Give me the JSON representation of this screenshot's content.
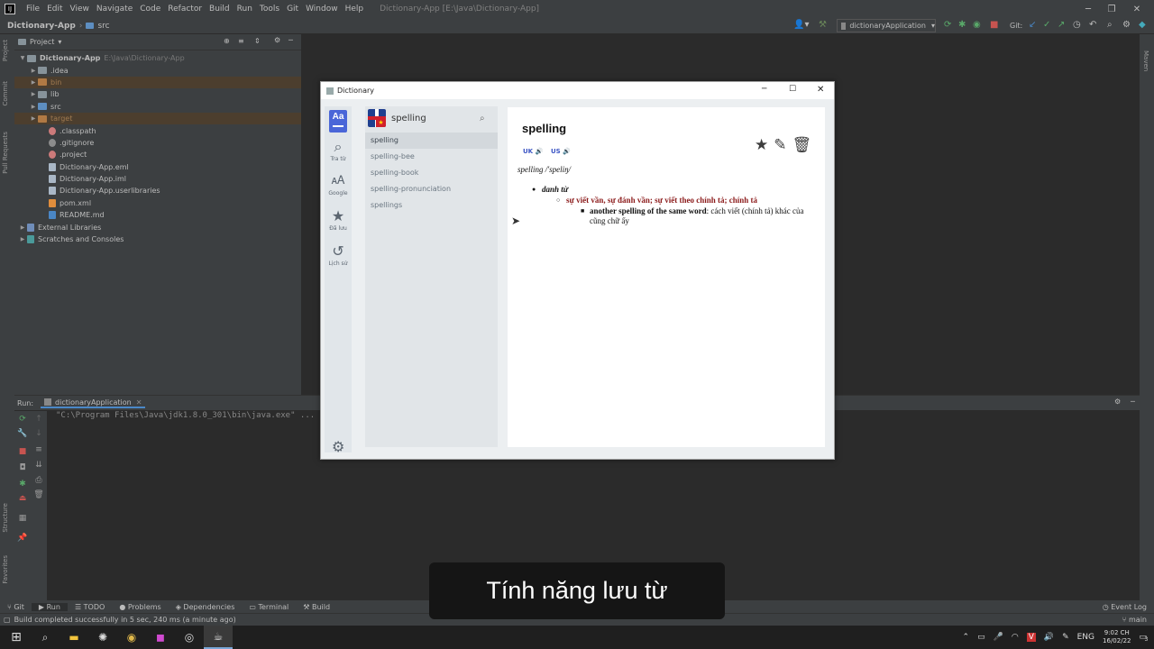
{
  "ide": {
    "menu": [
      "File",
      "Edit",
      "View",
      "Navigate",
      "Code",
      "Refactor",
      "Build",
      "Run",
      "Tools",
      "Git",
      "Window",
      "Help"
    ],
    "window_title": "Dictionary-App [E:\\Java\\Dictionary-App]",
    "breadcrumb": {
      "project": "Dictionary-App",
      "folder": "src"
    },
    "run_config": "dictionaryApplication",
    "git_label": "Git:",
    "left_strip": [
      "Project",
      "Commit",
      "Pull Requests",
      "Structure",
      "Favorites"
    ],
    "right_strip": [
      "Maven"
    ],
    "project_panel_title": "Project",
    "tree": [
      {
        "name": "Dictionary-App",
        "extra": "E:\\Java\\Dictionary-App",
        "level": 0,
        "type": "folder"
      },
      {
        "name": ".idea",
        "level": 1,
        "type": "folder"
      },
      {
        "name": "bin",
        "level": 1,
        "type": "folder-excluded"
      },
      {
        "name": "lib",
        "level": 1,
        "type": "folder"
      },
      {
        "name": "src",
        "level": 1,
        "type": "folder-src"
      },
      {
        "name": "target",
        "level": 1,
        "type": "folder-excluded"
      },
      {
        "name": ".classpath",
        "level": 2,
        "type": "file-red"
      },
      {
        "name": ".gitignore",
        "level": 2,
        "type": "file-grey"
      },
      {
        "name": ".project",
        "level": 2,
        "type": "file-red"
      },
      {
        "name": "Dictionary-App.eml",
        "level": 2,
        "type": "file"
      },
      {
        "name": "Dictionary-App.iml",
        "level": 2,
        "type": "file"
      },
      {
        "name": "Dictionary-App.userlibraries",
        "level": 2,
        "type": "file"
      },
      {
        "name": "pom.xml",
        "level": 2,
        "type": "file-m"
      },
      {
        "name": "README.md",
        "level": 2,
        "type": "file-md"
      },
      {
        "name": "External Libraries",
        "level": 0,
        "type": "lib"
      },
      {
        "name": "Scratches and Consoles",
        "level": 0,
        "type": "scratch"
      }
    ],
    "run_label": "Run:",
    "run_tab": "dictionaryApplication",
    "console_line": "\"C:\\Program Files\\Java\\jdk1.8.0_301\\bin\\java.exe\" ...",
    "bottom_tabs": [
      "Git",
      "Run",
      "TODO",
      "Problems",
      "Dependencies",
      "Terminal",
      "Build"
    ],
    "event_log": "Event Log",
    "status_text": "Build completed successfully in 5 sec, 240 ms (a minute ago)",
    "branch": "main"
  },
  "taskbar": {
    "lang": "ENG",
    "time": "9:02 CH",
    "date": "16/02/22",
    "notif_count": "3"
  },
  "subtitle": "Tính năng lưu từ",
  "dictionary": {
    "title": "Dictionary",
    "nav": [
      {
        "label": "Tra từ",
        "icon": "search-icon"
      },
      {
        "label": "Google",
        "icon": "translate-icon"
      },
      {
        "label": "Đã lưu",
        "icon": "star-icon"
      },
      {
        "label": "Lịch sử",
        "icon": "history-icon"
      }
    ],
    "logo_text": "Aa",
    "search_value": "spelling",
    "search_placeholder": "",
    "flag_star": "★",
    "suggestions": [
      "spelling",
      "spelling-bee",
      "spelling-book",
      "spelling-pronunciation",
      "spellings"
    ],
    "word": "spelling",
    "pron_uk": "UK",
    "pron_us": "US",
    "phonetic": "spelling /'speliŋ/",
    "pos": "danh từ",
    "meaning": "sự viết vần, sự đánh vần; sự viết theo chính tả; chính tả",
    "example_bold": "another spelling of the same word",
    "example_rest": ": cách viết (chính tả) khác của cũng chữ ấy",
    "accent_color": "#4a66d8",
    "meaning_color": "#8b1a1a"
  }
}
